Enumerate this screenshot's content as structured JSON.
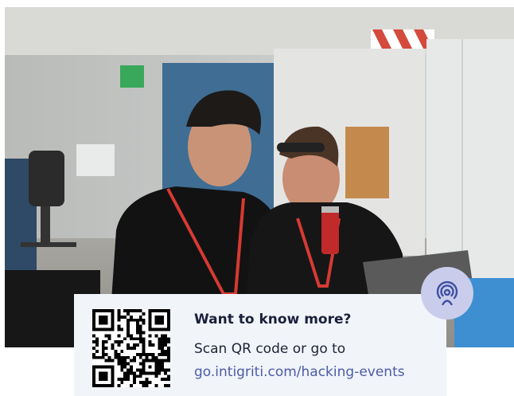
{
  "card": {
    "title": "Want to know more?",
    "line": "Scan QR code or go to",
    "link": "go.intigriti.com/hacking-events"
  },
  "icons": {
    "badge": "broadcast-person-icon",
    "qr": "qr-code"
  },
  "colors": {
    "card_background": "#f1f4f9",
    "title_text": "#1b1f3b",
    "link_text": "#4b5ba8",
    "badge_background": "#c9cdeb",
    "badge_icon": "#3f4fa3"
  }
}
